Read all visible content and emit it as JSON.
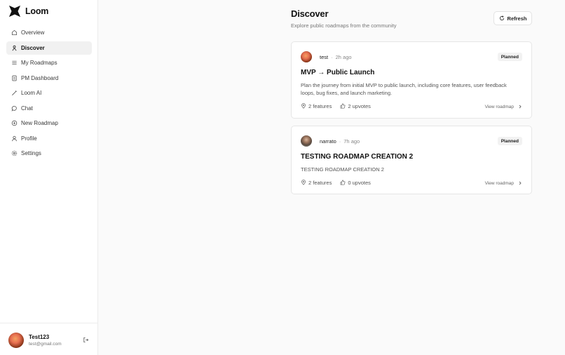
{
  "app": {
    "name": "Loom"
  },
  "sidebar": {
    "items": [
      {
        "label": "Overview",
        "icon": "home-icon"
      },
      {
        "label": "Discover",
        "icon": "discover-icon",
        "active": true
      },
      {
        "label": "My Roadmaps",
        "icon": "list-icon"
      },
      {
        "label": "PM Dashboard",
        "icon": "document-icon"
      },
      {
        "label": "Loom AI",
        "icon": "sparkle-wand-icon"
      },
      {
        "label": "Chat",
        "icon": "chat-icon"
      },
      {
        "label": "New Roadmap",
        "icon": "plus-circle-icon"
      },
      {
        "label": "Profile",
        "icon": "user-icon"
      },
      {
        "label": "Settings",
        "icon": "gear-icon"
      }
    ]
  },
  "user": {
    "name": "Test123",
    "email": "test@gmail.com"
  },
  "main": {
    "title": "Discover",
    "subtitle": "Explore public roadmaps from the community",
    "refresh_label": "Refresh"
  },
  "roadmaps": [
    {
      "author": "test",
      "time": "2h ago",
      "status": "Planned",
      "title": "MVP → Public Launch",
      "description": "Plan the journey from initial MVP to public launch, including core features, user feedback loops, bug fixes, and launch marketing.",
      "features": "2 features",
      "upvotes": "2 upvotes",
      "view_label": "View roadmap"
    },
    {
      "author": "narrato",
      "time": "7h ago",
      "status": "Planned",
      "title": "TESTING ROADMAP CREATION 2",
      "description": "TESTING ROADMAP CREATION 2",
      "features": "2 features",
      "upvotes": "0 upvotes",
      "view_label": "View roadmap"
    }
  ],
  "separator": "·",
  "colors": {
    "accent": "#111111",
    "active_bg": "#f1f1f1",
    "badge_bg": "#f2f2f2"
  }
}
